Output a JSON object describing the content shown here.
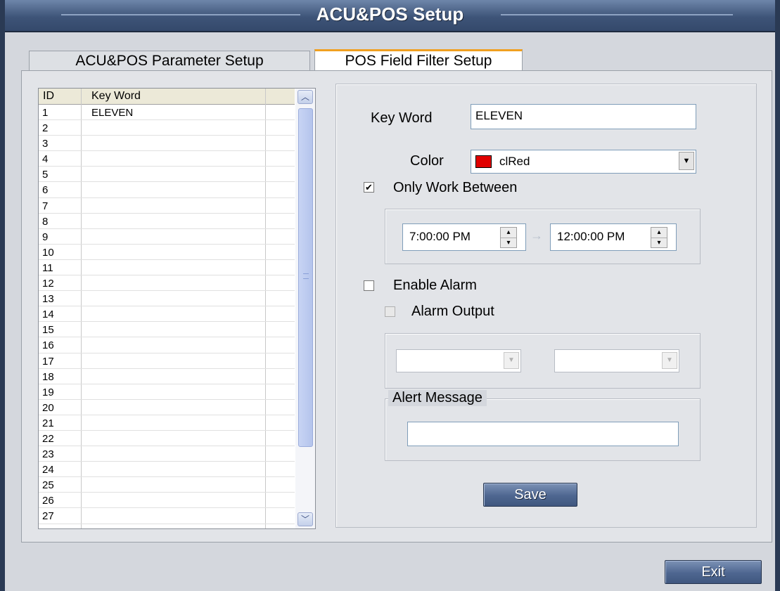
{
  "window": {
    "title": "ACU&POS Setup"
  },
  "tabs": [
    {
      "label": "ACU&POS Parameter Setup",
      "active": false
    },
    {
      "label": "POS Field Filter Setup",
      "active": true
    }
  ],
  "grid": {
    "columns": [
      "ID",
      "Key Word"
    ],
    "rows": [
      {
        "id": "1",
        "keyword": "ELEVEN"
      },
      {
        "id": "2",
        "keyword": ""
      },
      {
        "id": "3",
        "keyword": ""
      },
      {
        "id": "4",
        "keyword": ""
      },
      {
        "id": "5",
        "keyword": ""
      },
      {
        "id": "6",
        "keyword": ""
      },
      {
        "id": "7",
        "keyword": ""
      },
      {
        "id": "8",
        "keyword": ""
      },
      {
        "id": "9",
        "keyword": ""
      },
      {
        "id": "10",
        "keyword": ""
      },
      {
        "id": "11",
        "keyword": ""
      },
      {
        "id": "12",
        "keyword": ""
      },
      {
        "id": "13",
        "keyword": ""
      },
      {
        "id": "14",
        "keyword": ""
      },
      {
        "id": "15",
        "keyword": ""
      },
      {
        "id": "16",
        "keyword": ""
      },
      {
        "id": "17",
        "keyword": ""
      },
      {
        "id": "18",
        "keyword": ""
      },
      {
        "id": "19",
        "keyword": ""
      },
      {
        "id": "20",
        "keyword": ""
      },
      {
        "id": "21",
        "keyword": ""
      },
      {
        "id": "22",
        "keyword": ""
      },
      {
        "id": "23",
        "keyword": ""
      },
      {
        "id": "24",
        "keyword": ""
      },
      {
        "id": "25",
        "keyword": ""
      },
      {
        "id": "26",
        "keyword": ""
      },
      {
        "id": "27",
        "keyword": ""
      }
    ]
  },
  "form": {
    "keyword_label": "Key Word",
    "keyword_value": "ELEVEN",
    "color_label": "Color",
    "color_value": "clRed",
    "color_swatch": "#e00000",
    "only_work_between_label": "Only Work Between",
    "only_work_between_checked": true,
    "time_from": "7:00:00 PM",
    "time_to": "12:00:00 PM",
    "enable_alarm_label": "Enable Alarm",
    "enable_alarm_checked": false,
    "alarm_output_label": "Alarm Output",
    "alarm_output_checked": false,
    "alarm_select_1": "",
    "alarm_select_2": "",
    "alert_message_label": "Alert Message",
    "alert_message_value": "",
    "save_label": "Save"
  },
  "footer": {
    "exit_label": "Exit"
  },
  "icons": {
    "check": "✔",
    "scroll_up": "︿",
    "scroll_down": "﹀",
    "dropdown": "▼",
    "spin_up": "▴",
    "spin_down": "▾",
    "arrow_right": "→"
  }
}
